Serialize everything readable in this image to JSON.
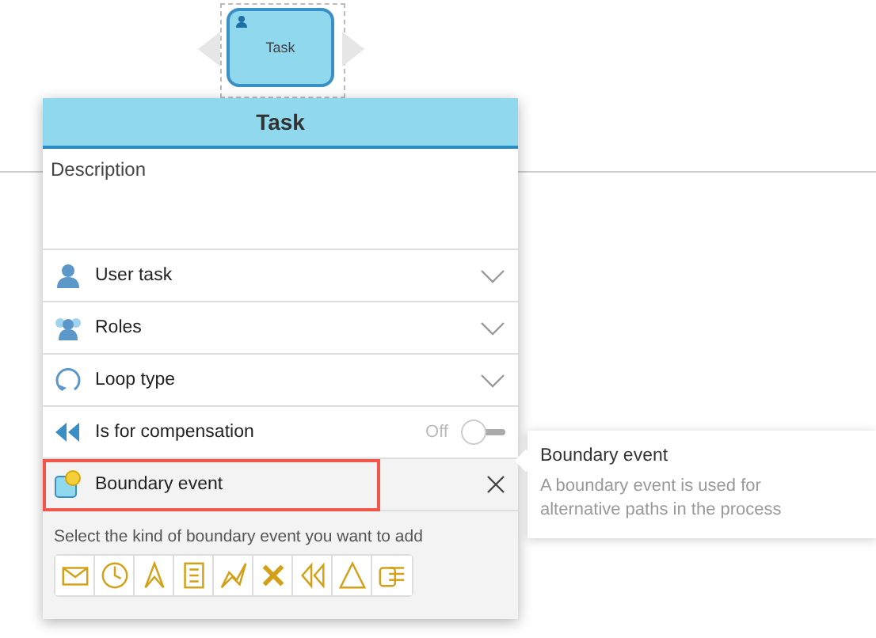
{
  "canvas_node": {
    "label": "Task"
  },
  "panel": {
    "title": "Task",
    "description": {
      "placeholder": "Description"
    },
    "rows": [
      {
        "kind": "dropdown",
        "label": "User task",
        "highlighted": false
      },
      {
        "kind": "dropdown",
        "label": "Roles",
        "highlighted": false
      },
      {
        "kind": "dropdown",
        "label": "Loop type",
        "highlighted": false
      },
      {
        "kind": "toggle",
        "label": "Is for compensation",
        "state_label": "Off",
        "on": false,
        "highlighted": false
      },
      {
        "kind": "close",
        "label": "Boundary event",
        "highlighted": true
      }
    ],
    "footer": {
      "hint": "Select the kind of boundary event you want to add"
    }
  },
  "tooltip": {
    "title": "Boundary event",
    "text": "A boundary event is used for alternative paths in the process"
  }
}
